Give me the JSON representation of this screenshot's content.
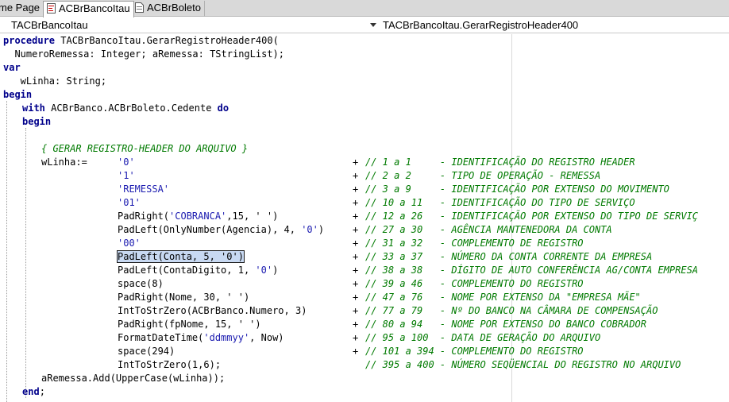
{
  "tabs": [
    {
      "label": "me Page",
      "icon": ""
    },
    {
      "label": "ACBrBancoItau",
      "icon": "unit-file-icon"
    },
    {
      "label": "ACBrBoleto",
      "icon": "document-icon"
    }
  ],
  "combos": {
    "left_value": "TACBrBancoItau",
    "right_value": "TACBrBancoItau.GerarRegistroHeader400"
  },
  "code": {
    "l1_kw": "procedure",
    "l1_rest": " TACBrBancoItau.GerarRegistroHeader400(",
    "l2": "  NumeroRemessa: Integer; aRemessa: TStringList);",
    "l3_kw": "var",
    "l4": "   wLinha: String;",
    "l5_kw": "begin",
    "l6_kw1": "with",
    "l6_mid": " ACBrBanco.ACBrBoleto.Cedente ",
    "l6_kw2": "do",
    "l7_kw": "begin",
    "l9_comment": "{ GERAR REGISTRO-HEADER DO ARQUIVO }",
    "l10_var": "wLinha:=",
    "rows": [
      {
        "pre": "",
        "str": "'0'",
        "post": "",
        "plus": "+",
        "comment": "// 1 a 1     - IDENTIFICAÇÃO DO REGISTRO HEADER"
      },
      {
        "pre": "",
        "str": "'1'",
        "post": "",
        "plus": "+",
        "comment": "// 2 a 2     - TIPO DE OPERAÇÃO - REMESSA"
      },
      {
        "pre": "",
        "str": "'REMESSA'",
        "post": "",
        "plus": "+",
        "comment": "// 3 a 9     - IDENTIFICAÇÃO POR EXTENSO DO MOVIMENTO"
      },
      {
        "pre": "",
        "str": "'01'",
        "post": "",
        "plus": "+",
        "comment": "// 10 a 11   - IDENTIFICAÇÃO DO TIPO DE SERVIÇO"
      },
      {
        "pre": "PadRight(",
        "str": "'COBRANCA'",
        "post": ",15, ' ')",
        "plus": "+",
        "comment": "// 12 a 26   - IDENTIFICAÇÃO POR EXTENSO DO TIPO DE SERVIÇ"
      },
      {
        "pre": "PadLeft(OnlyNumber(Agencia), 4, ",
        "str": "'0'",
        "post": ")",
        "plus": "+",
        "comment": "// 27 a 30   - AGÊNCIA MANTENEDORA DA CONTA"
      },
      {
        "pre": "",
        "str": "'00'",
        "post": "",
        "plus": "+",
        "comment": "// 31 a 32   - COMPLEMENTO DE REGISTRO"
      },
      {
        "pre": "PadLeft(Conta, 5, '0')",
        "str": "",
        "post": "",
        "plus": "+",
        "comment": "// 33 a 37   - NÚMERO DA CONTA CORRENTE DA EMPRESA",
        "selected": true
      },
      {
        "pre": "PadLeft(ContaDigito, 1, ",
        "str": "'0'",
        "post": ")",
        "plus": "+",
        "comment": "// 38 a 38   - DÍGITO DE AUTO CONFERÊNCIA AG/CONTA EMPRESA"
      },
      {
        "pre": "space(8)",
        "str": "",
        "post": "",
        "plus": "+",
        "comment": "// 39 a 46   - COMPLEMENTO DO REGISTRO"
      },
      {
        "pre": "PadRight(Nome, 30, ' ')",
        "str": "",
        "post": "",
        "plus": "+",
        "comment": "// 47 a 76   - NOME POR EXTENSO DA \"EMPRESA MÃE\""
      },
      {
        "pre": "IntToStrZero(ACBrBanco.Numero, 3)",
        "str": "",
        "post": "",
        "plus": "+",
        "comment": "// 77 a 79   - Nº DO BANCO NA CÂMARA DE COMPENSAÇÃO"
      },
      {
        "pre": "PadRight(fpNome, 15, ' ')",
        "str": "",
        "post": "",
        "plus": "+",
        "comment": "// 80 a 94   - NOME POR EXTENSO DO BANCO COBRADOR"
      },
      {
        "pre": "FormatDateTime(",
        "str": "'ddmmyy'",
        "post": ", Now)",
        "plus": "+",
        "comment": "// 95 a 100  - DATA DE GERAÇÃO DO ARQUIVO"
      },
      {
        "pre": "space(294)",
        "str": "",
        "post": "",
        "plus": "+",
        "comment": "// 101 a 394 - COMPLEMENTO DO REGISTRO"
      },
      {
        "pre": "IntToStrZero(1,6);",
        "str": "",
        "post": "",
        "plus": "",
        "comment": "// 395 a 400 - NÚMERO SEQÜENCIAL DO REGISTRO NO ARQUIVO"
      }
    ],
    "l27": "aRemessa.Add(UpperCase(wLinha));",
    "l28_kw": "end",
    "l28_rest": ";"
  },
  "colors": {
    "keyword": "#00008b",
    "string": "#1b1bb0",
    "comment": "#007a00",
    "selection": "#c8d9f2"
  }
}
